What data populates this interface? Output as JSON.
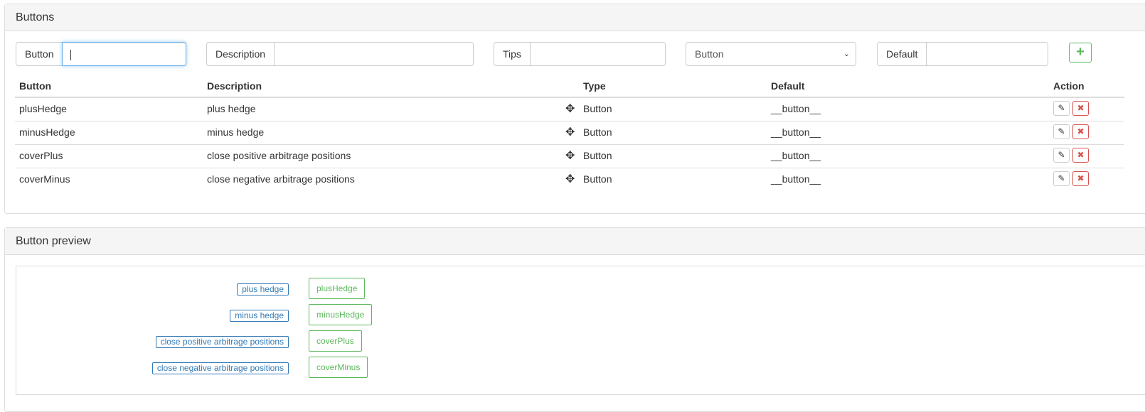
{
  "buttons_panel": {
    "title": "Buttons",
    "form": {
      "button_label": "Button",
      "button_value": "",
      "description_label": "Description",
      "description_value": "",
      "tips_label": "Tips",
      "tips_value": "",
      "type_selected": "Button",
      "default_label": "Default",
      "default_value": "",
      "add_label": "+"
    },
    "table": {
      "headers": [
        "Button",
        "Description",
        "Type",
        "Default",
        "Action"
      ],
      "rows": [
        {
          "button": "plusHedge",
          "description": "plus hedge",
          "type": "Button",
          "default": "__button__"
        },
        {
          "button": "minusHedge",
          "description": "minus hedge",
          "type": "Button",
          "default": "__button__"
        },
        {
          "button": "coverPlus",
          "description": "close positive arbitrage positions",
          "type": "Button",
          "default": "__button__"
        },
        {
          "button": "coverMinus",
          "description": "close negative arbitrage positions",
          "type": "Button",
          "default": "__button__"
        }
      ]
    }
  },
  "preview_panel": {
    "title": "Button preview",
    "items": [
      {
        "label": "plus hedge",
        "button": "plusHedge"
      },
      {
        "label": "minus hedge",
        "button": "minusHedge"
      },
      {
        "label": "close positive arbitrage positions",
        "button": "coverPlus"
      },
      {
        "label": "close negative arbitrage positions",
        "button": "coverMinus"
      }
    ]
  },
  "icons": {
    "move": "move-icon",
    "edit": "pencil-icon",
    "delete": "close-icon",
    "add": "plus-icon"
  },
  "colors": {
    "primary": "#337ab7",
    "success": "#5cb85c",
    "danger": "#d9534f",
    "focus": "#66afe9"
  }
}
